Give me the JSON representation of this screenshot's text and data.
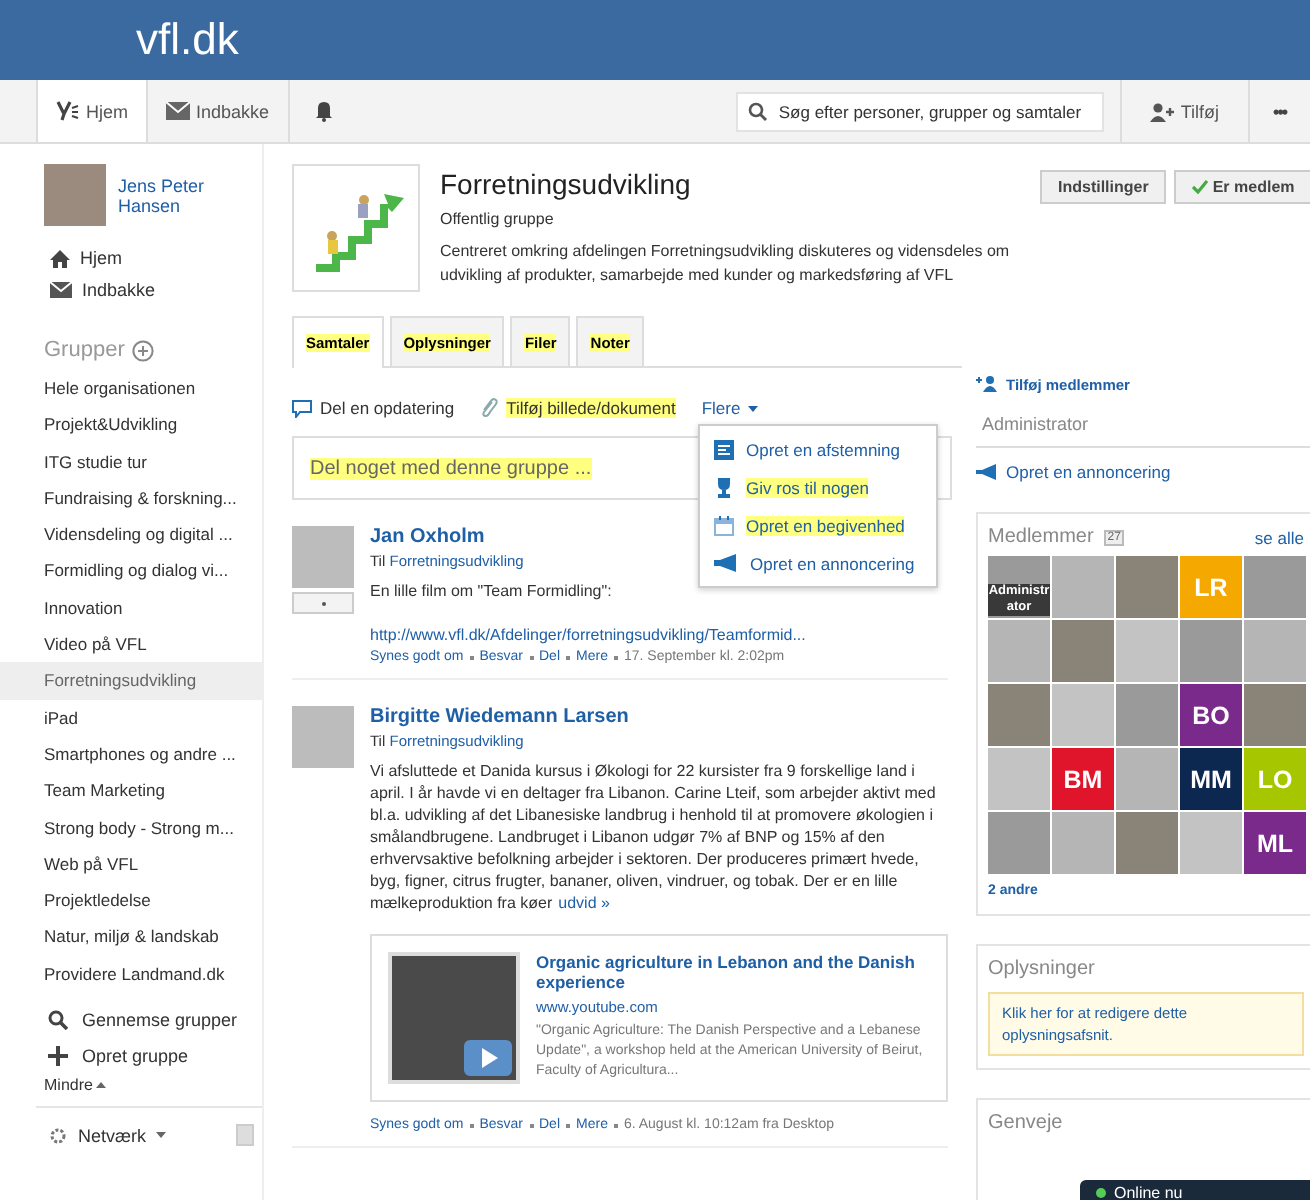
{
  "header": {
    "logo": "vfl.dk"
  },
  "nav": {
    "tabs": [
      {
        "label": "Hjem",
        "selected": true
      },
      {
        "label": "Indbakke",
        "selected": false
      }
    ],
    "search": {
      "placeholder": "Søg efter personer, grupper og samtaler"
    },
    "add_label": "Tilføj",
    "more": "•••"
  },
  "sidebar": {
    "user": {
      "name": "Jens Peter Hansen"
    },
    "links": [
      "Hjem",
      "Indbakke"
    ],
    "groups_heading": "Grupper",
    "groups": [
      {
        "label": "Hele organisationen",
        "selected": false
      },
      {
        "label": "Projekt&Udvikling",
        "selected": false
      },
      {
        "label": "ITG studie tur",
        "selected": false
      },
      {
        "label": "Fundraising & forskning...",
        "selected": false
      },
      {
        "label": "Vidensdeling og digital ...",
        "selected": false
      },
      {
        "label": "Formidling og dialog vi...",
        "selected": false
      },
      {
        "label": "Innovation",
        "selected": false
      },
      {
        "label": "Video på VFL",
        "selected": false
      },
      {
        "label": "Forretningsudvikling",
        "selected": true
      },
      {
        "label": "iPad",
        "selected": false
      },
      {
        "label": "Smartphones og andre ...",
        "selected": false
      },
      {
        "label": "Team Marketing",
        "selected": false
      },
      {
        "label": "Strong body - Strong m...",
        "selected": false
      },
      {
        "label": "Web på VFL",
        "selected": false
      },
      {
        "label": "Projektledelse",
        "selected": false
      },
      {
        "label": "Natur, miljø & landskab",
        "selected": false
      },
      {
        "label": "Providere Landmand.dk",
        "selected": false
      }
    ],
    "actions": [
      "Gennemse grupper",
      "Opret gruppe"
    ],
    "less": "Mindre",
    "network": "Netværk"
  },
  "group": {
    "title": "Forretningsudvikling",
    "type": "Offentlig gruppe",
    "description": "Centreret omkring afdelingen Forretningsudvikling diskuteres og vidensdeles om udvikling af produkter, samarbejde med kunder og markedsføring af VFL",
    "buttons": [
      {
        "label": "Indstillinger",
        "kind": "plain"
      },
      {
        "label": "Er medlem",
        "kind": "check"
      }
    ]
  },
  "tabs": [
    {
      "label": "Samtaler",
      "selected": true,
      "highlighted": true
    },
    {
      "label": "Oplysninger",
      "selected": false,
      "highlighted": true
    },
    {
      "label": "Filer",
      "selected": false,
      "highlighted": true
    },
    {
      "label": "Noter",
      "selected": false,
      "highlighted": true
    }
  ],
  "composer": {
    "actions": [
      {
        "label": "Del en opdatering",
        "highlighted": false
      },
      {
        "label": "Tilføj billede/dokument",
        "highlighted": true
      }
    ],
    "more": "Flere",
    "placeholder": "Del noget med denne gruppe ...",
    "placeholder_highlighted": true,
    "menu": [
      {
        "label": "Opret en afstemning",
        "highlighted": false
      },
      {
        "label": "Giv ros til nogen",
        "highlighted": true
      },
      {
        "label": "Opret en begivenhed",
        "highlighted": true
      },
      {
        "label": "Opret en annoncering",
        "highlighted": false
      }
    ]
  },
  "posts": [
    {
      "author": "Jan Oxholm",
      "to_prefix": "Til",
      "to": "Forretningsudvikling",
      "body": "En lille film om \"Team Formidling\":",
      "link": "http://www.vfl.dk/Afdelinger/forretningsudvikling/Teamformid...",
      "actions": [
        "Synes godt om",
        "Besvar",
        "Del",
        "Mere"
      ],
      "meta": "17. September kl. 2:02pm"
    },
    {
      "author": "Birgitte Wiedemann Larsen",
      "to_prefix": "Til",
      "to": "Forretningsudvikling",
      "body": "Vi afsluttede et Danida kursus i Økologi for 22 kursister fra 9 forskellige land i april. I år havde vi en deltager fra Libanon. Carine Lteif, som arbejder aktivt med bl.a. udvikling af det Libanesiske landbrug i henhold til at promovere økologien i smålandbrugene. Landbruget i Libanon udgør 7% af BNP og 15% af den erhvervsaktive befolkning arbejder i sektoren. Der produceres primært hvede, byg, figner, citrus frugter, bananer, oliven, vindruer, og tobak. Der er en lille mælkeproduktion fra køer",
      "expand": "udvid »",
      "attachment": {
        "title": "Organic agriculture in Lebanon and the Danish experience",
        "source": "www.youtube.com",
        "description": "\"Organic Agriculture: The Danish Perspective and a Lebanese Update\", a workshop held at the American University of Beirut, Faculty of Agricultura..."
      },
      "actions": [
        "Synes godt om",
        "Besvar",
        "Del",
        "Mere"
      ],
      "meta": "6. August kl. 10:12am fra Desktop"
    }
  ],
  "right": {
    "add_members": "Tilføj medlemmer",
    "admin_heading": "Administrator",
    "announce": "Opret en annoncering",
    "members": {
      "title": "Medlemmer",
      "count": "27",
      "see_all": "se alle",
      "others": "2 andre",
      "tiles": [
        {
          "kind": "photo",
          "badge": "Administrator"
        },
        {
          "kind": "photo"
        },
        {
          "kind": "photo"
        },
        {
          "kind": "initials",
          "text": "LR",
          "color": "#f5a800"
        },
        {
          "kind": "photo"
        },
        {
          "kind": "photo"
        },
        {
          "kind": "photo"
        },
        {
          "kind": "photo"
        },
        {
          "kind": "photo"
        },
        {
          "kind": "photo"
        },
        {
          "kind": "photo"
        },
        {
          "kind": "photo"
        },
        {
          "kind": "photo"
        },
        {
          "kind": "initials",
          "text": "BO",
          "color": "#7a2a8a"
        },
        {
          "kind": "photo"
        },
        {
          "kind": "photo"
        },
        {
          "kind": "initials",
          "text": "BM",
          "color": "#e0152b"
        },
        {
          "kind": "photo"
        },
        {
          "kind": "initials",
          "text": "MM",
          "color": "#0c2750"
        },
        {
          "kind": "initials",
          "text": "LO",
          "color": "#a6c700"
        },
        {
          "kind": "photo"
        },
        {
          "kind": "photo"
        },
        {
          "kind": "photo"
        },
        {
          "kind": "photo"
        },
        {
          "kind": "initials",
          "text": "ML",
          "color": "#7a2a8a"
        }
      ]
    },
    "info": {
      "title": "Oplysninger",
      "prompt": "Klik her for at redigere dette oplysningsafsnit."
    },
    "shortcuts": {
      "title": "Genveje"
    }
  },
  "chat": {
    "label": "Online nu"
  }
}
